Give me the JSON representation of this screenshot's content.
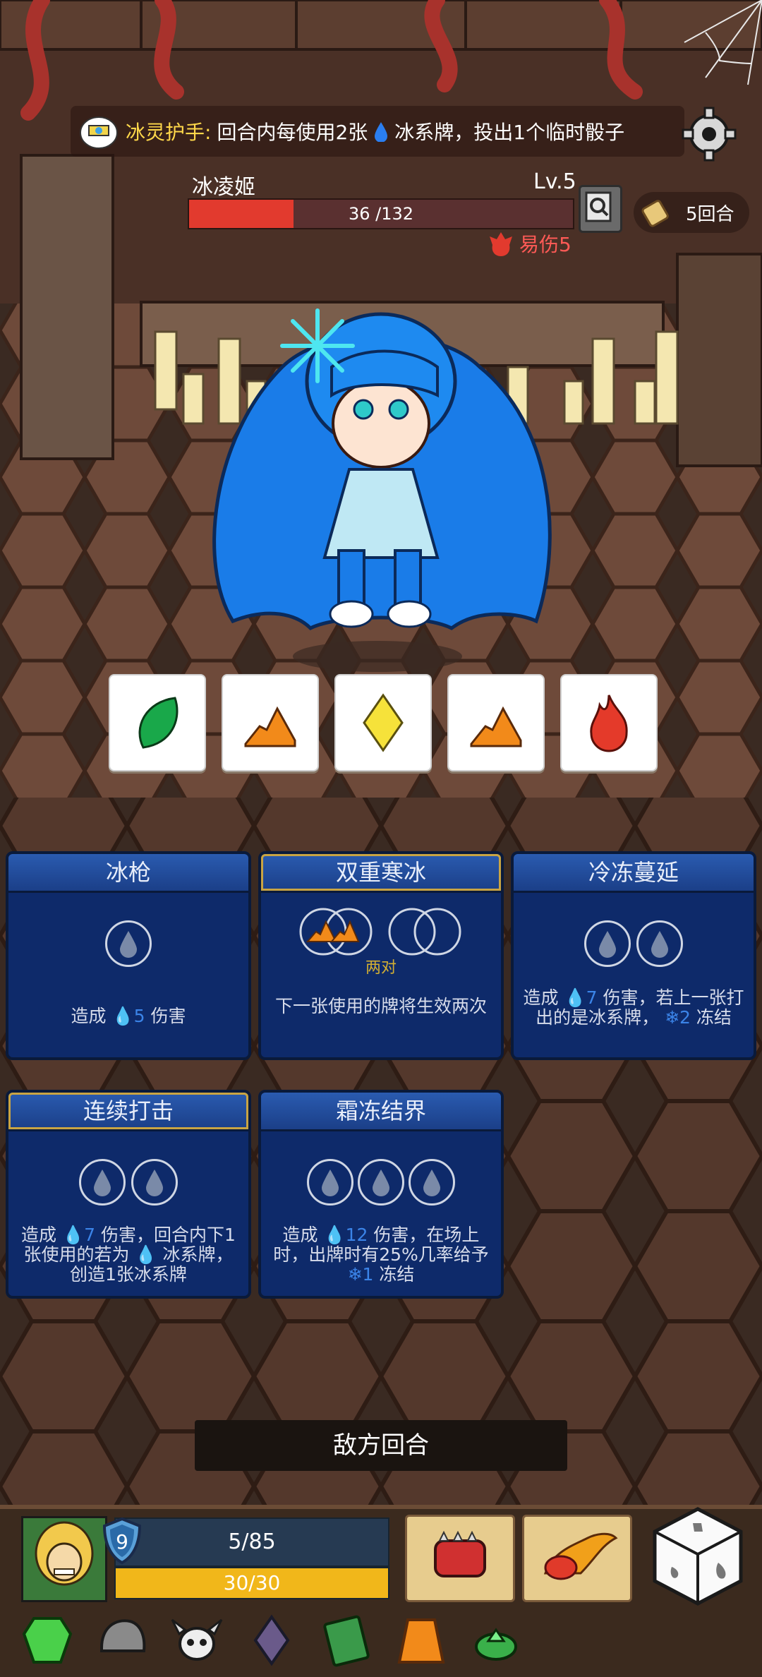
{
  "banner": {
    "title": "冰灵护手:",
    "text_before": "回合内每使用2张",
    "text_after": "冰系牌，投出1个临时骰子"
  },
  "enemy": {
    "name": "冰凌姬",
    "level": "Lv.5",
    "hp_text": "36 /132",
    "hp_current": 36,
    "hp_max": 132,
    "debuff_label": "易伤5"
  },
  "turn_counter": "5回合",
  "dice": [
    {
      "icon": "leaf-die-icon",
      "color": "#19a84a"
    },
    {
      "icon": "rock-die-icon",
      "color": "#f28a1a"
    },
    {
      "icon": "diamond-die-icon",
      "color": "#f6e23a"
    },
    {
      "icon": "rock-die-icon",
      "color": "#f28a1a"
    },
    {
      "icon": "fire-die-icon",
      "color": "#e43a2a"
    }
  ],
  "cards": [
    {
      "title": "冰枪",
      "desc_pre": "造成",
      "desc_num": "5",
      "desc_post": "伤害"
    },
    {
      "title": "双重寒冰",
      "sub_label": "两对",
      "desc": "下一张使用的牌将生效两次"
    },
    {
      "title": "冷冻蔓延",
      "desc_a": "造成",
      "num1": "7",
      "desc_b": "伤害，若上一张打出的是冰系牌，",
      "num2": "2",
      "desc_c": "冻结"
    },
    {
      "title": "连续打击",
      "desc_a": "造成",
      "num1": "7",
      "desc_b": "伤害，回合内下1张使用的若为",
      "desc_c": "冰系牌，创造1张冰系牌"
    },
    {
      "title": "霜冻结界",
      "desc_a": "造成",
      "num1": "12",
      "desc_b": "伤害，在场上时，出牌时有25%几率给予",
      "num2": "1",
      "desc_c": "冻结"
    }
  ],
  "enemy_turn_label": "敌方回合",
  "player": {
    "shield": "9",
    "mp_text": "5/85",
    "hp_text": "30/30",
    "hp_fraction": 1.0
  },
  "colors": {
    "enemy_hp": "#e23a2e",
    "player_hp": "#f1b71a",
    "card_bg": "#0e2a6a"
  },
  "items": [
    "green-gem-icon",
    "iron-helmet-icon",
    "horned-skull-icon",
    "dark-crystal-icon",
    "green-spellbook-icon",
    "orange-robe-icon",
    "emerald-ring-icon"
  ]
}
